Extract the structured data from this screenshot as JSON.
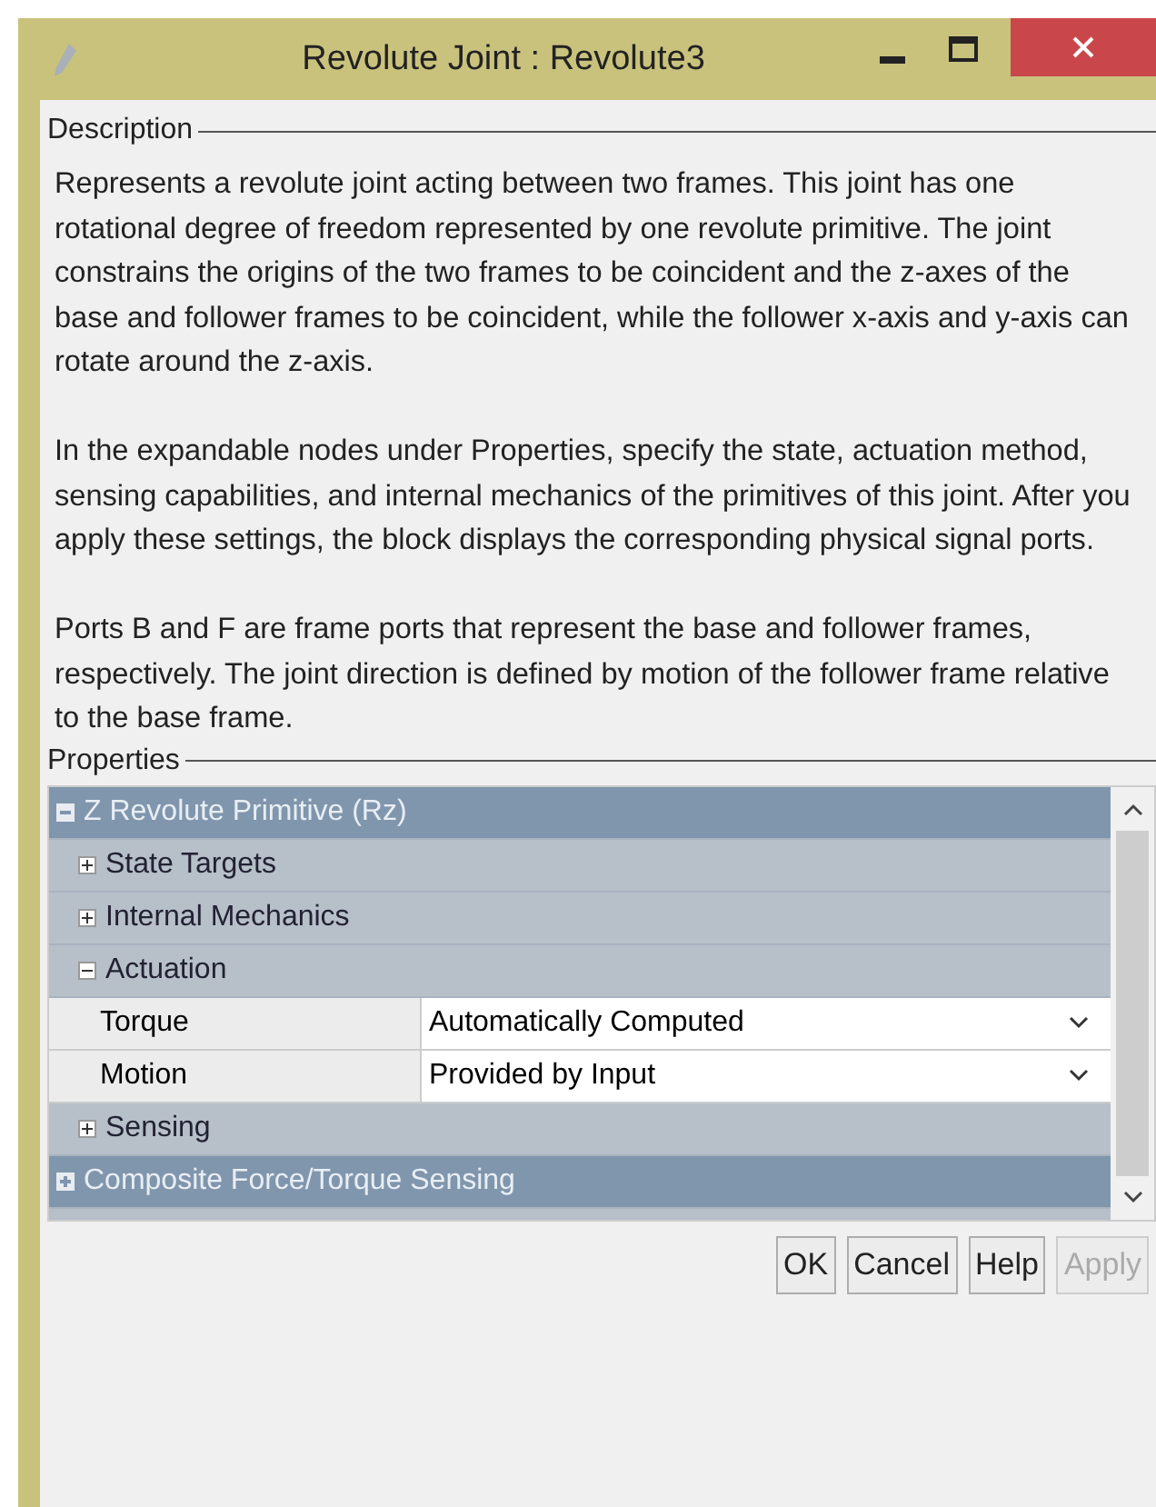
{
  "window": {
    "title": "Revolute Joint : Revolute3"
  },
  "description": {
    "legend": "Description",
    "paragraphs": [
      "Represents a revolute joint acting between two frames. This joint has one rotational degree of freedom represented by one revolute primitive. The joint constrains the origins of the two frames to be coincident and the z-axes of the base and follower frames to be coincident, while the follower x-axis and y-axis can rotate around the z-axis.",
      "In the expandable nodes under Properties, specify the state, actuation method, sensing capabilities, and internal mechanics of the primitives of this joint. After you apply these settings, the block displays the corresponding physical signal ports.",
      "Ports B and F are frame ports that represent the base and follower frames, respectively. The joint direction is defined by motion of the follower frame relative to the base frame."
    ]
  },
  "properties": {
    "legend": "Properties",
    "tree": [
      {
        "kind": "group",
        "label": "Z Revolute Primitive (Rz)",
        "expanded": true,
        "children": [
          {
            "kind": "node",
            "label": "State Targets",
            "expanded": false
          },
          {
            "kind": "node",
            "label": "Internal Mechanics",
            "expanded": false
          },
          {
            "kind": "node",
            "label": "Actuation",
            "expanded": true,
            "children": [
              {
                "kind": "param",
                "label": "Torque",
                "value": "Automatically Computed"
              },
              {
                "kind": "param",
                "label": "Motion",
                "value": "Provided by Input"
              }
            ]
          },
          {
            "kind": "node",
            "label": "Sensing",
            "expanded": false
          }
        ]
      },
      {
        "kind": "group",
        "label": "Composite Force/Torque Sensing",
        "expanded": false
      }
    ]
  },
  "buttons": [
    {
      "label": "OK",
      "disabled": false
    },
    {
      "label": "Cancel",
      "disabled": false
    },
    {
      "label": "Help",
      "disabled": false
    },
    {
      "label": "Apply",
      "disabled": true
    }
  ]
}
